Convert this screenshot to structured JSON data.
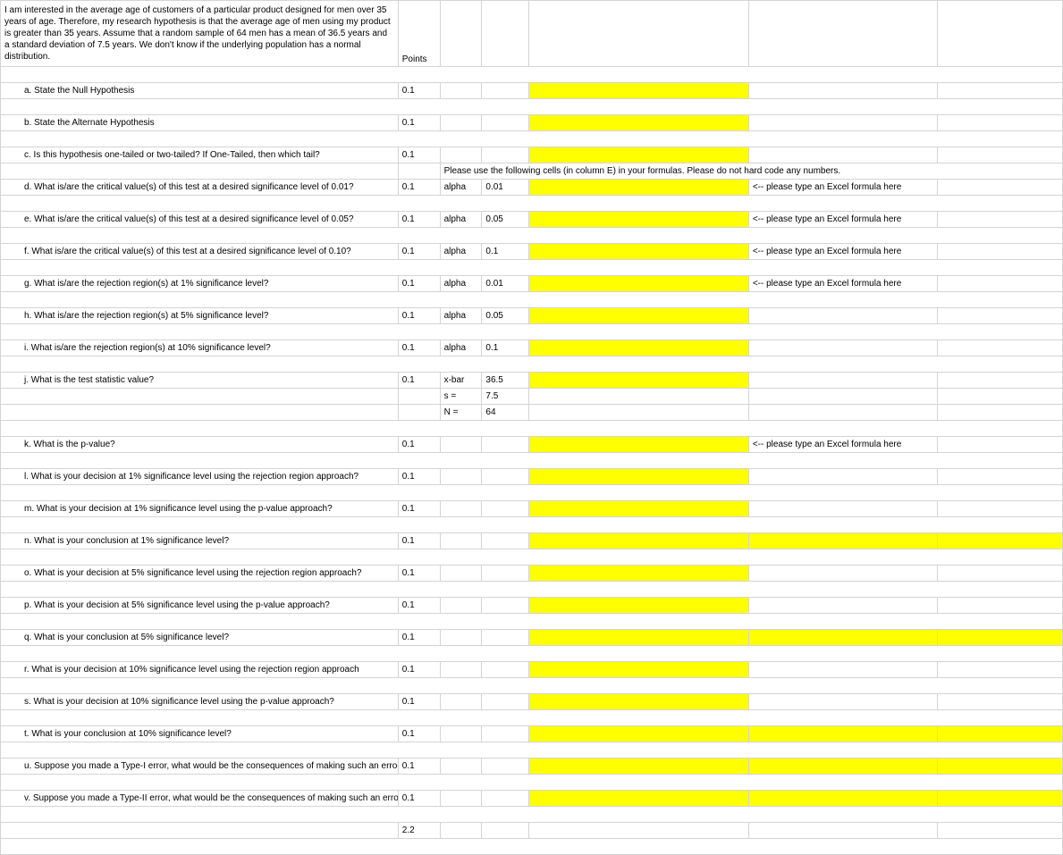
{
  "intro": "I am interested in the average age of customers of a particular product designed for men over 35 years of age. Therefore, my research hypothesis is that the average age of men using my product is greater than 35 years. Assume that a random sample of 64 men has a  mean of 36.5 years and a standard deviation of 7.5 years. We don't know if the underlying population has a normal distribution.",
  "pointsHeader": "Points",
  "instruction": "Please use the following cells (in column E) in your formulas.  Please do not hard code any numbers.",
  "formulaHint": "<-- please type an Excel formula here",
  "pointsVal": "0.1",
  "total": "2.2",
  "params": {
    "alpha": "alpha",
    "a001": "0.01",
    "a005": "0.05",
    "a010": "0.1",
    "xbar_l": "x-bar",
    "xbar_v": "36.5",
    "s_l": "s =",
    "s_v": "7.5",
    "n_l": "N =",
    "n_v": "64"
  },
  "q": {
    "a": "a.   State the Null Hypothesis",
    "b": "b.   State the Alternate Hypothesis",
    "c": "c.   Is this hypothesis one-tailed or two-tailed?  If One-Tailed, then which tail?",
    "d": "d.   What is/are the critical value(s) of this test at a desired significance level of 0.01?",
    "e": "e.   What is/are the critical value(s) of this test at a desired significance level of 0.05?",
    "f": "f.   What is/are the critical value(s) of this test at a desired significance level of 0.10?",
    "g": "g.   What is/are the rejection region(s) at 1% significance level?",
    "h": "h.   What is/are the rejection region(s) at 5% significance level?",
    "i": "i.   What is/are the rejection region(s) at 10% significance level?",
    "j": "j.   What is the test statistic value?",
    "k": "k.   What is the p-value?",
    "l": "l.   What is your decision at 1% significance level using the rejection region approach?",
    "m": "m.   What is your decision at 1% significance level using the p-value approach?",
    "n": "n.   What is your conclusion at 1% significance level?",
    "o": "o.   What is your decision at 5% significance level using the rejection region approach?",
    "p": "p.   What is your decision at 5% significance level using the p-value approach?",
    "q": "q.   What is your conclusion at 5% significance level?",
    "r": "r.   What is your decision at 10% significance level using the rejection region approach",
    "s": "s.   What is your decision at 10% significance level using the p-value approach?",
    "t": "t.   What is your conclusion at 10% significance level?",
    "u": "u.   Suppose you made a Type-I error, what would be the consequences of making such an error",
    "v": "v.   Suppose you made a Type-II error, what would be the consequences of making such an error"
  }
}
